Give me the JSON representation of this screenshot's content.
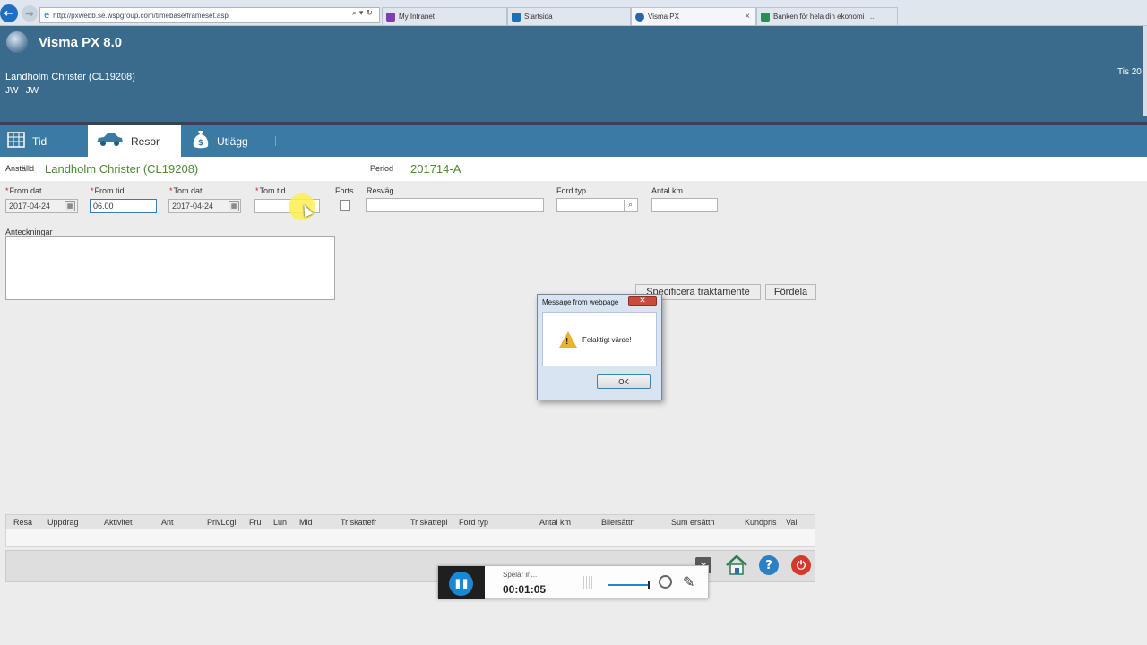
{
  "browser": {
    "url": "http://pxwebb.se.wspgroup.com/timebase/frameset.asp",
    "tabs": [
      {
        "label": "My Intranet",
        "active": false
      },
      {
        "label": "Startsida",
        "active": false
      },
      {
        "label": "Visma PX",
        "active": true
      },
      {
        "label": "Banken för hela din ekonomi | ...",
        "active": false
      }
    ],
    "close_glyph": "×"
  },
  "header": {
    "app_title": "Visma PX 8.0",
    "user_name": "Landholm Christer (CL19208)",
    "user_sub": "JW | JW",
    "date_label": "Tis 20"
  },
  "nav": {
    "tabs": [
      {
        "label": "Tid",
        "icon": "grid-icon",
        "active": false
      },
      {
        "label": "Resor",
        "icon": "car-icon",
        "active": true
      },
      {
        "label": "Utlägg",
        "icon": "money-bag-icon",
        "active": false
      }
    ]
  },
  "info": {
    "employee_label": "Anställd",
    "employee_value": "Landholm Christer (CL19208)",
    "period_label": "Period",
    "period_value": "201714-A"
  },
  "form": {
    "from_date_label": "From dat",
    "from_date_value": "2017-04-24",
    "from_time_label": "From tid",
    "from_time_value": "06.00",
    "to_date_label": "Tom dat",
    "to_date_value": "2017-04-24",
    "to_time_label": "Tom tid",
    "to_time_value": "",
    "forts_label": "Forts",
    "resvag_label": "Resväg",
    "resvag_value": "",
    "vehicle_label": "Ford typ",
    "vehicle_value": "",
    "km_label": "Antal km",
    "km_value": "",
    "notes_label": "Anteckningar",
    "specify_button": "Specificera traktamente",
    "distribute_button": "Fördela"
  },
  "grid": {
    "columns": [
      "Resa",
      "Uppdrag",
      "Aktivitet",
      "Ant",
      "PrivLogi",
      "Fru",
      "Lun",
      "Mid",
      "Tr skattefr",
      "Tr skattepl",
      "Ford typ",
      "Antal km",
      "Bilersättn",
      "Sum ersättn",
      "Kundpris",
      "Val"
    ],
    "rows": []
  },
  "dialog": {
    "title": "Message from webpage",
    "message": "Felaktigt värde!",
    "ok_label": "OK"
  },
  "recorder": {
    "status": "Spelar in...",
    "time": "00:01:05"
  }
}
